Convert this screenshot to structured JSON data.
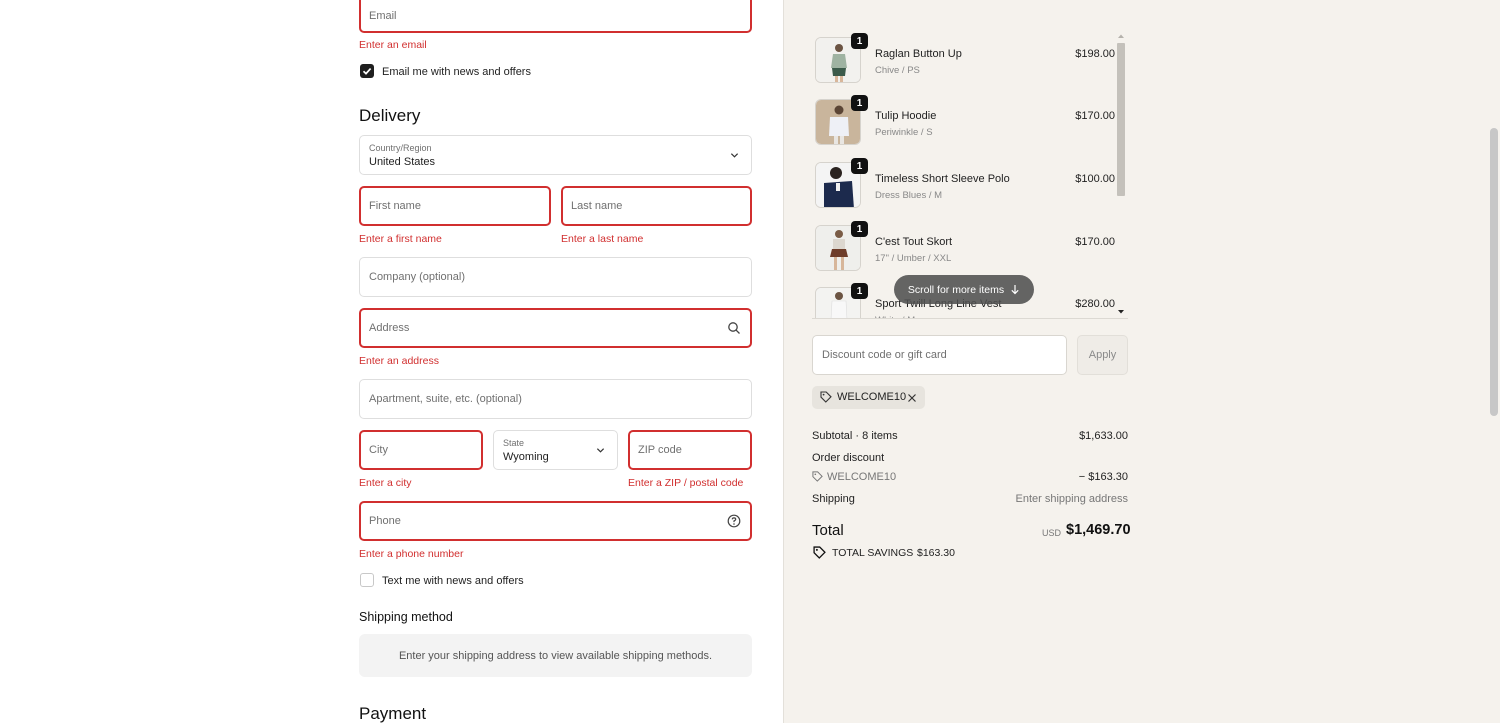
{
  "contact": {
    "email_placeholder": "Email",
    "email_error": "Enter an email",
    "newsletter_label": "Email me with news and offers",
    "newsletter_checked": true
  },
  "delivery": {
    "heading": "Delivery",
    "country_label": "Country/Region",
    "country_value": "United States",
    "first_name_placeholder": "First name",
    "first_name_error": "Enter a first name",
    "last_name_placeholder": "Last name",
    "last_name_error": "Enter a last name",
    "company_placeholder": "Company (optional)",
    "address_placeholder": "Address",
    "address_error": "Enter an address",
    "apartment_placeholder": "Apartment, suite, etc. (optional)",
    "city_placeholder": "City",
    "city_error": "Enter a city",
    "state_label": "State",
    "state_value": "Wyoming",
    "zip_placeholder": "ZIP code",
    "zip_error": "Enter a ZIP / postal code",
    "phone_placeholder": "Phone",
    "phone_error": "Enter a phone number",
    "sms_label": "Text me with news and offers",
    "sms_checked": false
  },
  "shipping": {
    "heading": "Shipping method",
    "message": "Enter your shipping address to view available shipping methods."
  },
  "payment": {
    "heading": "Payment"
  },
  "cart": {
    "items": [
      {
        "name": "Raglan Button Up",
        "variant": "Chive / PS",
        "price": "$198.00",
        "qty": "1"
      },
      {
        "name": "Tulip Hoodie",
        "variant": "Periwinkle / S",
        "price": "$170.00",
        "qty": "1"
      },
      {
        "name": "Timeless Short Sleeve Polo",
        "variant": "Dress Blues / M",
        "price": "$100.00",
        "qty": "1"
      },
      {
        "name": "C'est Tout Skort",
        "variant": "17\" / Umber / XXL",
        "price": "$170.00",
        "qty": "1"
      },
      {
        "name": "Sport Twill Long Line Vest",
        "variant": "White / M",
        "price": "$280.00",
        "qty": "1"
      }
    ],
    "scroll_hint": "Scroll for more items"
  },
  "discount": {
    "placeholder": "Discount code or gift card",
    "apply_label": "Apply",
    "applied_code": "WELCOME10"
  },
  "summary": {
    "subtotal_label": "Subtotal · 8 items",
    "subtotal_value": "$1,633.00",
    "order_discount_label": "Order discount",
    "discount_code": "WELCOME10",
    "discount_value": "− $163.30",
    "shipping_label": "Shipping",
    "shipping_value": "Enter shipping address",
    "total_label": "Total",
    "currency": "USD",
    "total_value": "$1,469.70",
    "savings_label": "TOTAL SAVINGS",
    "savings_value": "$163.30"
  },
  "colors": {
    "error": "#d12f2f",
    "sidebar_bg": "#f5f2ed"
  }
}
